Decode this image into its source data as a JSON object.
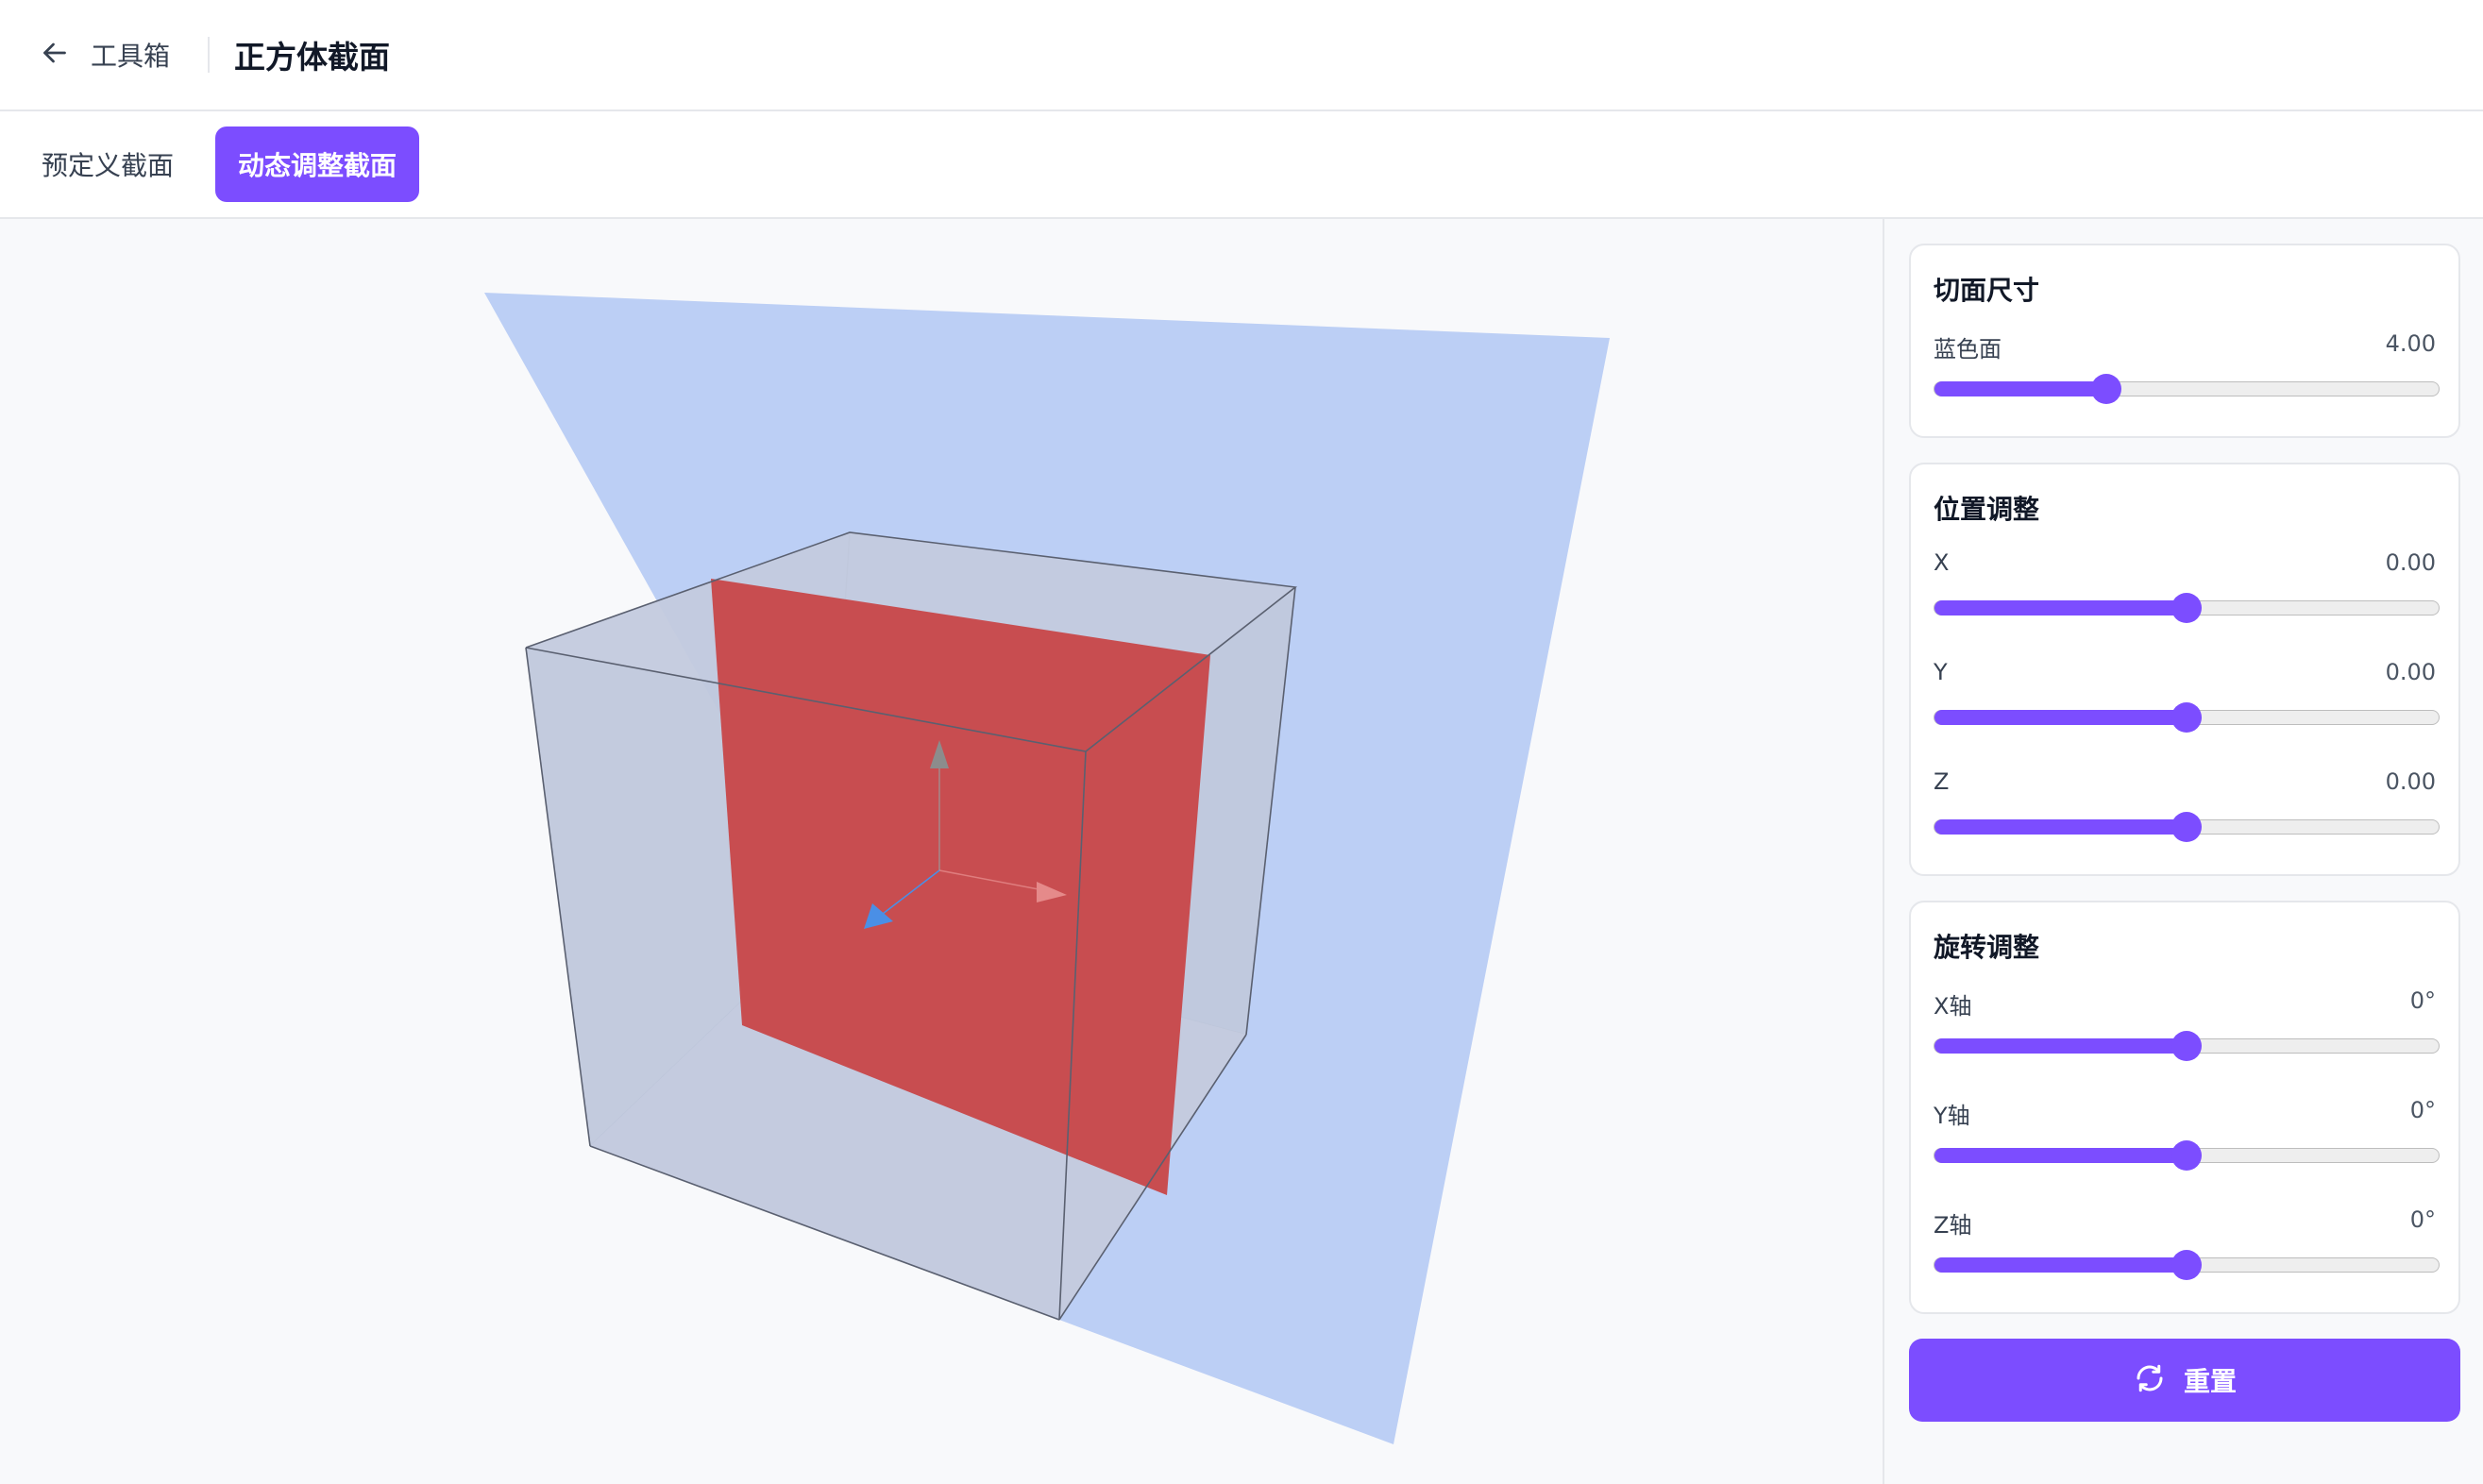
{
  "header": {
    "back_label": "工具箱",
    "title": "正方体截面",
    "back_icon": "arrow-left-icon"
  },
  "tabs": [
    {
      "label": "预定义截面",
      "active": false
    },
    {
      "label": "动态调整截面",
      "active": true
    }
  ],
  "panel": {
    "size": {
      "title": "切面尺寸",
      "sliders": [
        {
          "label": "蓝色面",
          "value_text": "4.00",
          "fraction": 0.34
        }
      ]
    },
    "position": {
      "title": "位置调整",
      "sliders": [
        {
          "label": "X",
          "value_text": "0.00",
          "fraction": 0.5
        },
        {
          "label": "Y",
          "value_text": "0.00",
          "fraction": 0.5
        },
        {
          "label": "Z",
          "value_text": "0.00",
          "fraction": 0.5
        }
      ]
    },
    "rotation": {
      "title": "旋转调整",
      "sliders": [
        {
          "label": "X轴",
          "value_text": "0°",
          "fraction": 0.5
        },
        {
          "label": "Y轴",
          "value_text": "0°",
          "fraction": 0.5
        },
        {
          "label": "Z轴",
          "value_text": "0°",
          "fraction": 0.5
        }
      ]
    },
    "reset": {
      "label": "重置",
      "icon": "refresh-icon"
    }
  },
  "colors": {
    "accent": "#7c4dff",
    "blue_plane": "#bccff5",
    "red_section": "#c84d50",
    "cube_face": "#c0c8dc",
    "axis_x": "#e58a8a",
    "axis_y": "#8c8c8c",
    "axis_z": "#4a8fe6"
  }
}
